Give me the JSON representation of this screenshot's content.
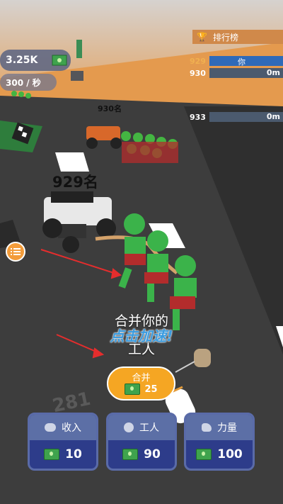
{
  "hud": {
    "money": "3.25K",
    "rate": "300 / 秒"
  },
  "leaderboard": {
    "title": "排行榜",
    "rows": [
      {
        "rank": "929",
        "name": "你",
        "distance": ""
      },
      {
        "rank": "930",
        "name": "",
        "distance": "0m"
      },
      {
        "rank": "933",
        "name": "",
        "distance": "0m"
      }
    ]
  },
  "race": {
    "rank_top": "930名",
    "rank_player": "929名",
    "distance_marker": "281"
  },
  "merge": {
    "prompt_line1": "合并你的",
    "prompt_line2": "工人",
    "tap_hint": "点击加速!",
    "button_label": "合并",
    "button_cost": "25"
  },
  "upgrades": [
    {
      "label": "收入",
      "cost": "10",
      "icon": "coins-icon"
    },
    {
      "label": "工人",
      "cost": "90",
      "icon": "worker-icon"
    },
    {
      "label": "力量",
      "cost": "100",
      "icon": "strength-icon"
    }
  ],
  "colors": {
    "merge_button": "#f5a623",
    "upgrade_panel": "#2d3c8a",
    "worker": "#3bb34a",
    "road": "#3a3a3a",
    "sand": "#e8a24a"
  }
}
